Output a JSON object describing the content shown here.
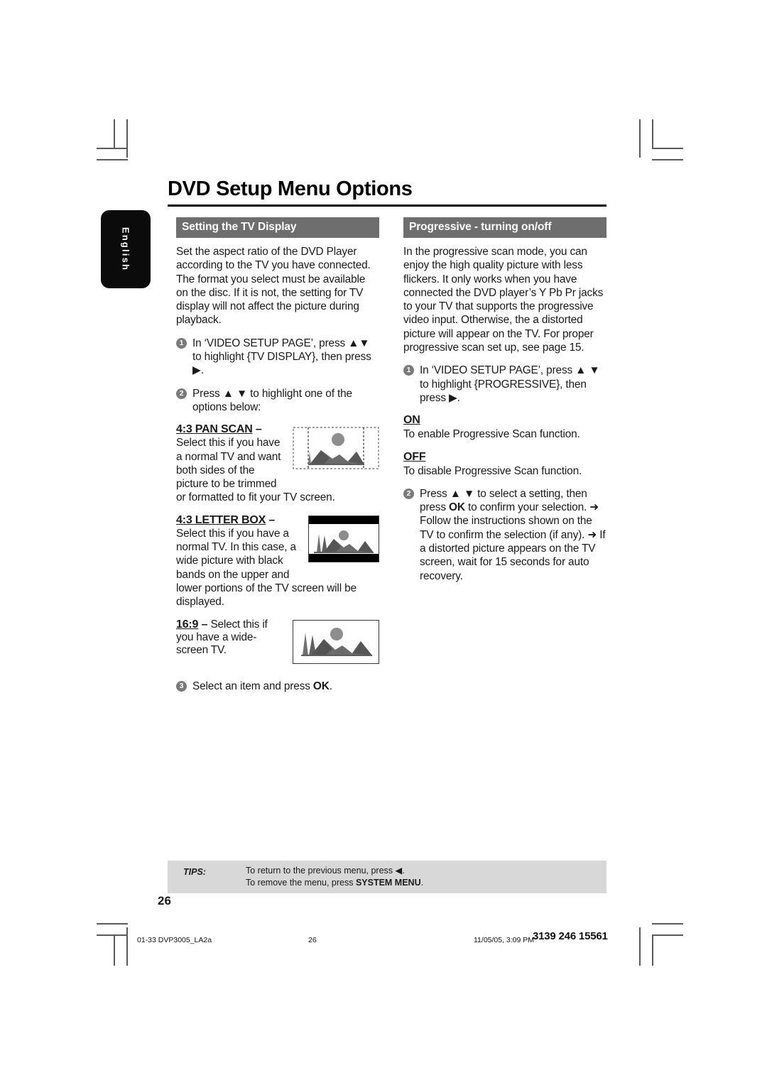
{
  "document": {
    "title": "DVD Setup Menu Options",
    "language_tab": "English",
    "page_number": "26"
  },
  "left_column": {
    "section_title": "Setting the TV Display",
    "intro": "Set the aspect ratio of the DVD Player according to the TV you have connected. The format you select must be available on the disc.  If it is not, the setting for TV display will not affect the picture during playback.",
    "steps": [
      {
        "num": "1",
        "text_a": "In ‘VIDEO SETUP PAGE’, press ",
        "text_b": " to highlight {TV DISPLAY}, then press ",
        "text_c": "."
      },
      {
        "num": "2",
        "text_a": "Press ",
        "text_b": " to highlight one of the options below:"
      },
      {
        "num": "3",
        "text_a": "Select an item and press ",
        "text_b": "OK",
        "text_c": "."
      }
    ],
    "options": [
      {
        "heading": "4:3 PAN SCAN",
        "dash": " –",
        "body": "Select this if you have a normal TV and want both sides of the picture to be trimmed or formatted to fit your TV screen.",
        "illustration": "pan-scan-diagram"
      },
      {
        "heading": "4:3 LETTER BOX",
        "dash": " –",
        "body": "Select this if you have a normal TV. In this case, a wide picture with black bands on the upper and lower portions of the TV screen will be displayed.",
        "illustration": "letter-box-diagram"
      },
      {
        "heading": "16:9",
        "dash": " – ",
        "body": "Select this if you have a wide-screen TV.",
        "illustration": "widescreen-diagram"
      }
    ]
  },
  "right_column": {
    "section_title": "Progressive - turning on/off",
    "intro": "In the progressive scan mode, you can enjoy the high quality picture with less flickers.  It only works when you have connected the DVD player’s Y Pb Pr jacks to your TV that supports the progressive video input.  Otherwise, the a distorted picture will appear on the TV.  For proper progressive scan set up, see page 15.",
    "steps": [
      {
        "num": "1",
        "text_a": "In ‘VIDEO SETUP PAGE’, press ",
        "text_b": " to highlight {PROGRESSIVE}, then press ",
        "text_c": "."
      },
      {
        "num": "2",
        "text_a": "Press ",
        "text_b": " to select a setting, then press ",
        "text_c": "OK",
        "text_d": " to confirm your selection.",
        "note_1": "Follow the instructions shown on the TV to confirm the selection (if any).",
        "note_2": "If a distorted picture appears on the TV screen, wait for 15 seconds for auto recovery."
      }
    ],
    "settings": [
      {
        "name": "ON",
        "description": "To enable Progressive Scan function."
      },
      {
        "name": "OFF",
        "description": "To disable Progressive Scan function."
      }
    ]
  },
  "tips": {
    "label": "TIPS:",
    "line1_a": "To return to the previous menu, press ",
    "line1_b": ".",
    "line2_a": "To remove the menu, press ",
    "line2_b": "SYSTEM MENU",
    "line2_c": "."
  },
  "footer": {
    "file": "01-33 DVP3005_LA2a",
    "page": "26",
    "date": "11/05/05, 3:09 PM",
    "code": "3139 246 15561"
  },
  "icons": {
    "up_triangle": "▲",
    "down_triangle": "▼",
    "right_triangle": "▶",
    "left_triangle": "◀",
    "arrow_right": "➜"
  },
  "colors": {
    "section_bar": "#6e6e6e",
    "tab_background": "#0b0b0b",
    "tips_background": "#d8d8d8",
    "bullet": "#7a7a7a"
  }
}
